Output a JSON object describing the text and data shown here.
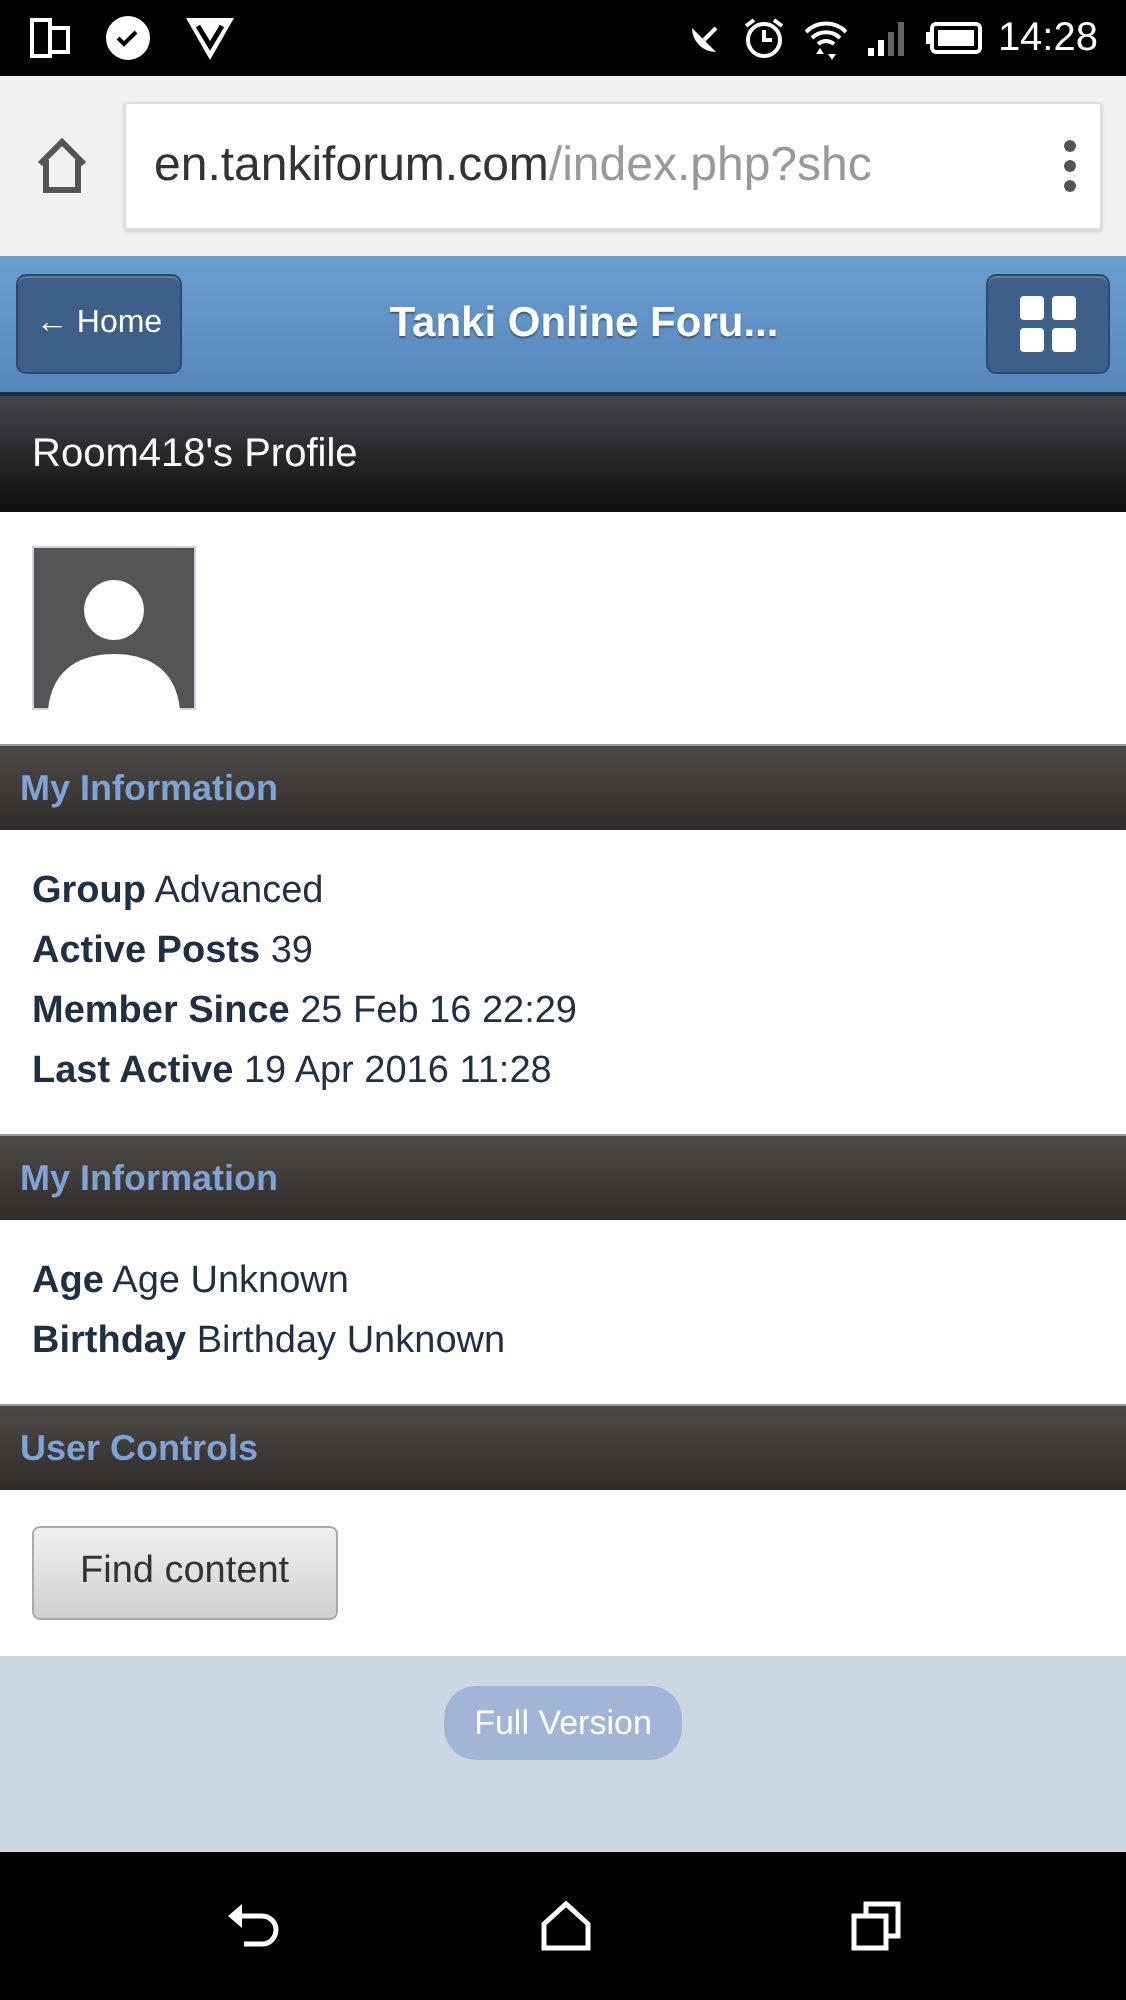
{
  "status_bar": {
    "time": "14:28"
  },
  "browser": {
    "url_host": "en.tankiforum.com",
    "url_path": "/index.php?shc"
  },
  "header": {
    "back_button": "← Home",
    "title": "Tanki Online Foru..."
  },
  "profile_title": "Room418's Profile",
  "sections": [
    {
      "title": "My Information",
      "kind": "fields",
      "fields": [
        {
          "label": "Group",
          "value": "Advanced"
        },
        {
          "label": "Active Posts",
          "value": "39"
        },
        {
          "label": "Member Since",
          "value": "25 Feb 16 22:29"
        },
        {
          "label": "Last Active",
          "value": "19 Apr 2016 11:28"
        }
      ]
    },
    {
      "title": "My Information",
      "kind": "fields",
      "fields": [
        {
          "label": "Age",
          "value": "Age Unknown"
        },
        {
          "label": "Birthday",
          "value": "Birthday Unknown"
        }
      ]
    },
    {
      "title": "User Controls",
      "kind": "buttons",
      "buttons": [
        "Find content"
      ]
    }
  ],
  "footer": {
    "button": "Full Version"
  }
}
